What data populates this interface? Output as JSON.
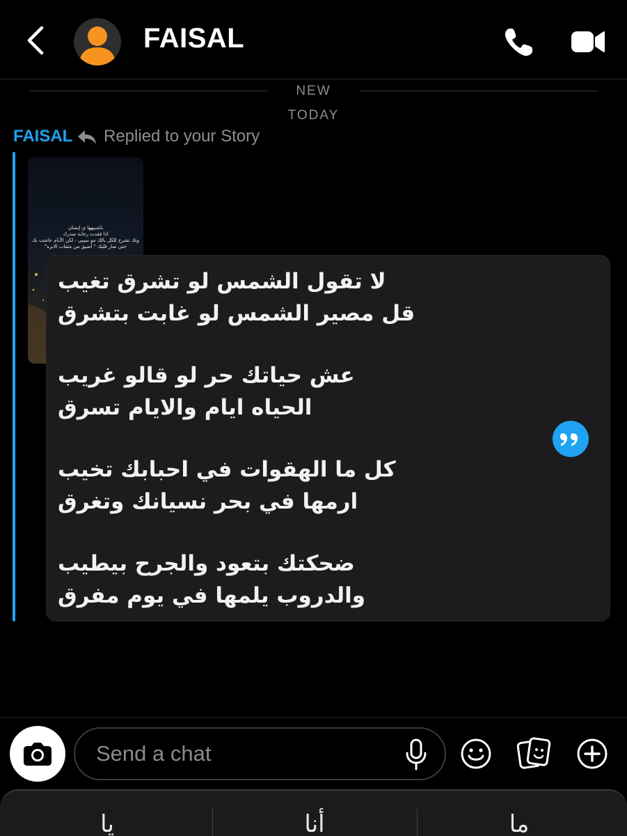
{
  "header": {
    "contact_name": "FAISAL"
  },
  "separators": {
    "new_label": "NEW",
    "today_label": "TODAY"
  },
  "message": {
    "sender": "FAISAL",
    "reply_context": "Replied to your Story",
    "story_caption": [
      "باشبيهها ي إنسان",
      "اذا فقدت رحابة صدرك",
      "وتك تشرح للكل بالك مو سيبي ، لكن الأيام عاشت بك",
      "حتى صار قلبك \" أضيق من مثقاب الابره\""
    ],
    "poem_lines": [
      "لا تقول الشمس لو تشرق تغيب",
      "قل مصير الشمس لو غابت بتشرق",
      "",
      "عش حياتك حر لو قالو  غريب",
      "الحياه ايام والايام تسرق",
      "",
      "كل ما الهقوات في احبابك تخيب",
      "ارمها في بحر نسيانك وتغرق",
      "",
      "ضحكتك بتعود والجرح بيطيب",
      "والدروب يلمها في يوم مفرق"
    ]
  },
  "chat_input": {
    "placeholder": "Send a chat"
  },
  "keyboard_suggestions": [
    "يا",
    "أنا",
    "ما"
  ],
  "colors": {
    "accent": "#1fa3f2",
    "background": "#000000",
    "bubble": "#1c1c1e",
    "muted_text": "#8e8e8e",
    "avatar_orange": "#f7931e"
  },
  "icons": {
    "back": "chevron-left-icon",
    "call": "phone-icon",
    "video": "video-camera-icon",
    "reply": "reply-arrow-icon",
    "quote": "quote-icon",
    "camera": "camera-icon",
    "mic": "microphone-icon",
    "emoji": "smiley-icon",
    "sticker": "sticker-icon",
    "plus": "plus-circle-icon"
  }
}
